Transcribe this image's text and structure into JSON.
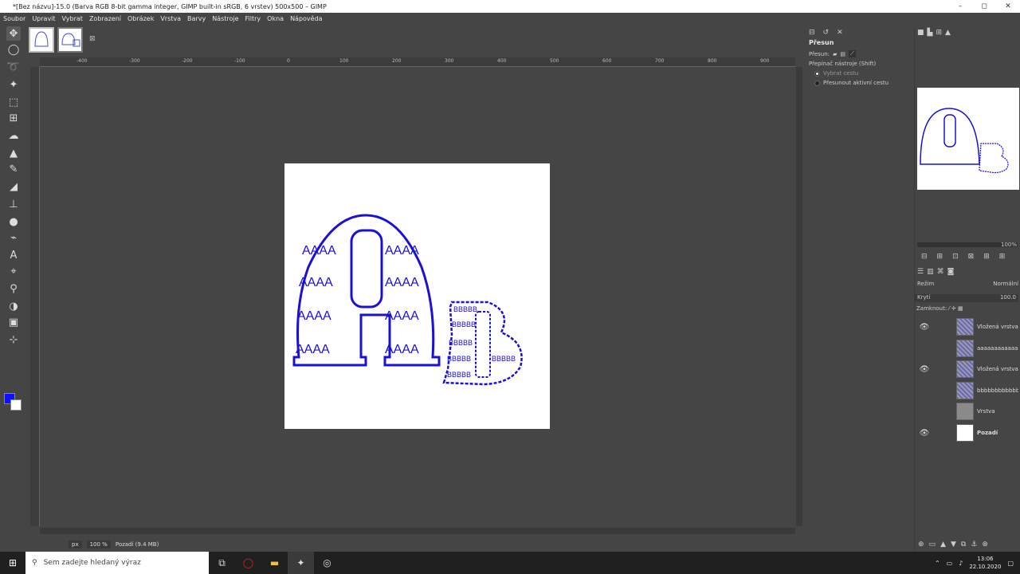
{
  "window": {
    "title": "*[Bez názvu]-15.0 (Barva RGB 8-bit gamma integer, GIMP built-in sRGB, 6 vrstev) 500x500 – GIMP",
    "minimize": "–",
    "maximize": "◻",
    "close": "✕"
  },
  "menu": [
    "Soubor",
    "Upravit",
    "Vybrat",
    "Zobrazení",
    "Obrázek",
    "Vrstva",
    "Barvy",
    "Nástroje",
    "Filtry",
    "Okna",
    "Nápověda"
  ],
  "ruler": {
    "h_labels": [
      "-400",
      "-300",
      "-200",
      "-100",
      "0",
      "100",
      "200",
      "300",
      "400",
      "500",
      "600",
      "700",
      "800",
      "900"
    ]
  },
  "canvas": {
    "image_size": "500x500",
    "letter_a_pattern": "AAAA",
    "letter_b_pattern": "BBBBB"
  },
  "tool_options": {
    "title": "Přesun",
    "move_label": "Přesun:",
    "switch_label": "Přepínač nástroje (Shift)",
    "option_pick": "Vybrat cestu",
    "option_move": "Přesunout aktivní cestu"
  },
  "navigator": {
    "zoom": "100%"
  },
  "layers_panel": {
    "mode_label": "Režim",
    "mode_value": "Normální",
    "opacity_label": "Krytí",
    "opacity_value": "100.0",
    "lock_label": "Zamknout:",
    "layers": [
      {
        "name": "Vložená vrstva",
        "visible": true,
        "thumb": "pattern",
        "bold": false
      },
      {
        "name": "aaaaaaaaaaaaa",
        "visible": false,
        "thumb": "pattern",
        "bold": false
      },
      {
        "name": "Vložená vrstva #1",
        "visible": true,
        "thumb": "pattern",
        "bold": false
      },
      {
        "name": "bbbbbbbbbbbbbbb",
        "visible": false,
        "thumb": "pattern",
        "bold": false
      },
      {
        "name": "Vrstva",
        "visible": false,
        "thumb": "gray",
        "bold": false
      },
      {
        "name": "Pozadí",
        "visible": true,
        "thumb": "white",
        "bold": true
      }
    ]
  },
  "status": {
    "unit": "px",
    "zoom": "100 %",
    "layer_info": "Pozadí (9.4 MB)"
  },
  "taskbar": {
    "search_placeholder": "Sem zadejte hledaný výraz",
    "time": "13:06",
    "date": "22.10.2020"
  },
  "colors": {
    "foreground": "#1010ff",
    "background": "#ffffff",
    "stroke": "#1a10d8"
  }
}
